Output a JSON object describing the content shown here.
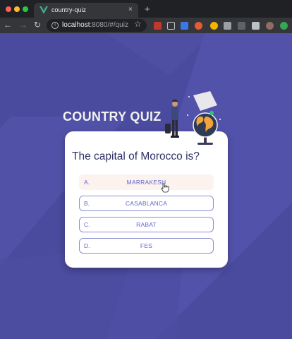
{
  "browser": {
    "tab_title": "country-quiz",
    "tab_close": "×",
    "new_tab": "+",
    "url_host": "localhost",
    "url_rest": ":8080/#/quiz",
    "back": "←",
    "forward": "→",
    "reload": "↻",
    "star": "☆"
  },
  "quiz": {
    "title": "COUNTRY QUIZ",
    "question": "The capital of Morocco is?",
    "options": [
      {
        "letter": "A.",
        "text": "MARRAKESH"
      },
      {
        "letter": "B.",
        "text": "CASABLANCA"
      },
      {
        "letter": "C.",
        "text": "RABAT"
      },
      {
        "letter": "D.",
        "text": "FES"
      }
    ]
  },
  "colors": {
    "background": "#4a4a9e",
    "title": "#f2f2f2",
    "question": "#2f3165",
    "option_accent": "#6066d0",
    "hover_bg": "#fcf2ee"
  }
}
